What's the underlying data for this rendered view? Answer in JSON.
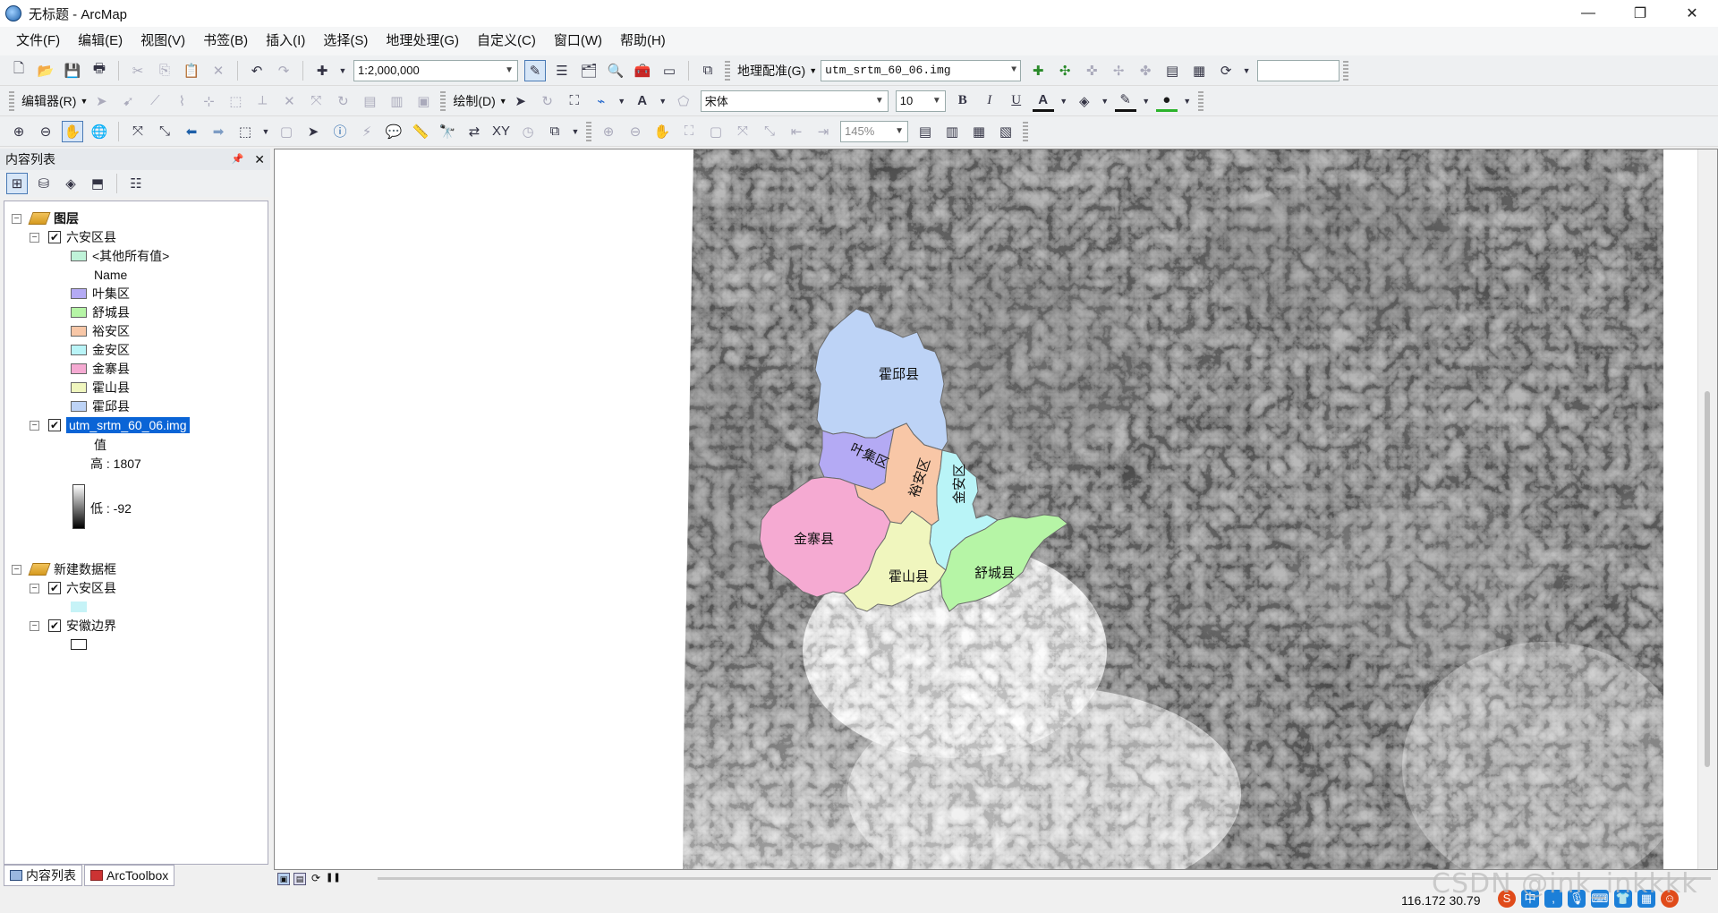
{
  "window": {
    "title": "无标题 - ArcMap",
    "minimize": "—",
    "maximize": "❐",
    "close": "✕"
  },
  "menu": [
    "文件(F)",
    "编辑(E)",
    "视图(V)",
    "书签(B)",
    "插入(I)",
    "选择(S)",
    "地理处理(G)",
    "自定义(C)",
    "窗口(W)",
    "帮助(H)"
  ],
  "toolbar1": {
    "scale": "1:2,000,000",
    "georef_label": "地理配准(G)",
    "georef_layer": "utm_srtm_60_06.img"
  },
  "toolbar2": {
    "editor_label": "编辑器(R)",
    "draw_label": "绘制(D)",
    "font_name": "宋体",
    "font_size": "10",
    "bold": "B",
    "italic": "I",
    "underline": "U",
    "font_color_glyph": "A"
  },
  "toolbar3": {
    "zoom_percent": "145%"
  },
  "toc": {
    "header": "内容列表",
    "pin": "📌",
    "close": "✕",
    "tree": {
      "frame1": "图层",
      "layer_liuan": "六安区县",
      "other_values": "<其他所有值>",
      "field_name": "Name",
      "classes": [
        {
          "label": "叶集区",
          "color": "#b4aaf4"
        },
        {
          "label": "舒城县",
          "color": "#b6f5a6"
        },
        {
          "label": "裕安区",
          "color": "#f8c7a7"
        },
        {
          "label": "金安区",
          "color": "#b9f4f7"
        },
        {
          "label": "金寨县",
          "color": "#f5aad2"
        },
        {
          "label": "霍山县",
          "color": "#f0f6be"
        },
        {
          "label": "霍邱县",
          "color": "#bdd3f6"
        }
      ],
      "other_color": "#bff2d8",
      "raster_layer": "utm_srtm_60_06.img",
      "value_label": "值",
      "high_label": "高 : 1807",
      "low_label": "低 : -92",
      "frame2": "新建数据框",
      "layer_liuan2": "六安区县",
      "layer_liuan2_color": "#c6f3f7",
      "layer_border": "安徽边界"
    },
    "tabs": [
      "内容列表",
      "ArcToolbox"
    ]
  },
  "map": {
    "labels": {
      "huoqiu": "霍邱县",
      "yeji": "叶集区",
      "yuan": "裕安区",
      "jinan": "金安区",
      "jinzhai": "金寨县",
      "huoshan": "霍山县",
      "shucheng": "舒城县"
    }
  },
  "status": {
    "coords": "116.172  30.79"
  },
  "watermark": "CSDN @ink_inkkkk"
}
